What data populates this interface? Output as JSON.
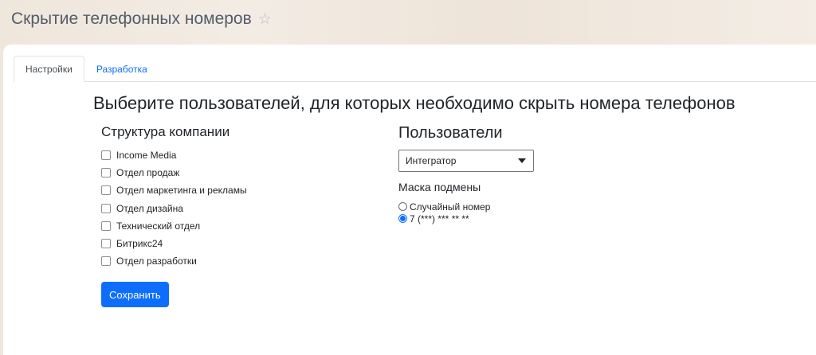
{
  "header": {
    "title": "Скрытие телефонных номеров"
  },
  "tabs": [
    {
      "label": "Настройки",
      "active": true
    },
    {
      "label": "Разработка",
      "active": false
    }
  ],
  "main": {
    "heading": "Выберите пользователей, для которых необходимо скрыть номера телефонов",
    "structure": {
      "title": "Структура компании",
      "items": [
        {
          "label": "Income Media",
          "checked": false
        },
        {
          "label": "Отдел продаж",
          "checked": false
        },
        {
          "label": "Отдел маркетинга и рекламы",
          "checked": false
        },
        {
          "label": "Отдел дизайна",
          "checked": false
        },
        {
          "label": "Технический отдел",
          "checked": false
        },
        {
          "label": "Битрикс24",
          "checked": false
        },
        {
          "label": "Отдел разработки",
          "checked": false
        }
      ],
      "save_label": "Сохранить"
    },
    "users": {
      "title": "Пользователи",
      "selected": "Интегратор",
      "mask_title": "Маска подмены",
      "options": [
        {
          "label": "Случайный номер",
          "checked": false
        },
        {
          "label": "7 (***) *** ** **",
          "checked": true
        }
      ]
    }
  },
  "colors": {
    "accent": "#0d6efd",
    "title": "#535c69"
  },
  "icons": {
    "favorite": "star-icon",
    "dropdown": "chevron-down-icon"
  }
}
